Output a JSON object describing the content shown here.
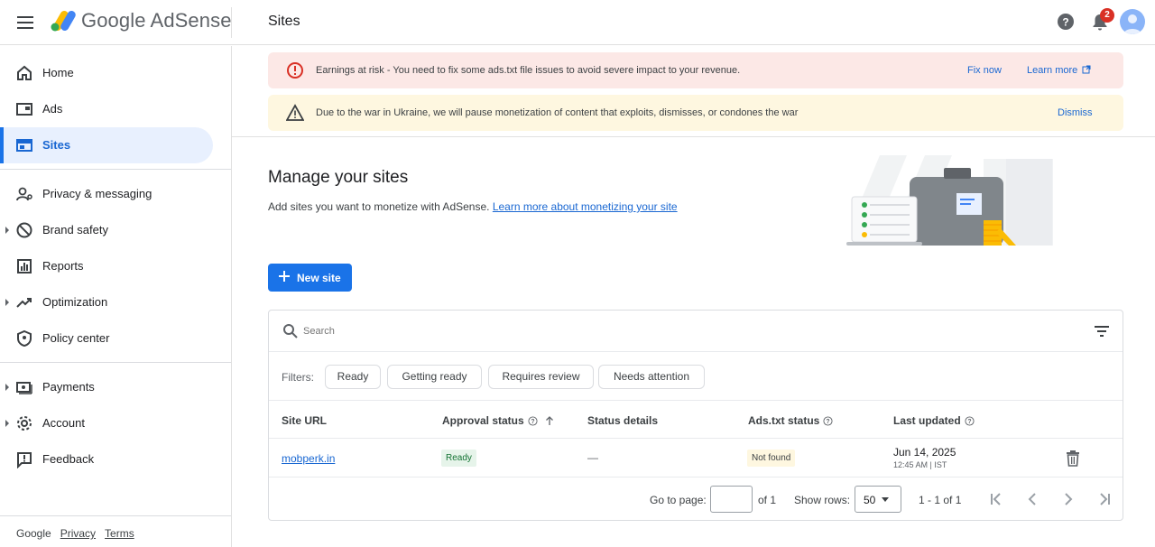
{
  "header": {
    "logo_text": "Google AdSense",
    "page_title": "Sites",
    "notification_count": "2"
  },
  "sidebar": {
    "items": [
      {
        "label": "Home",
        "icon": "home-icon"
      },
      {
        "label": "Ads",
        "icon": "ads-icon"
      },
      {
        "label": "Sites",
        "icon": "sites-icon",
        "active": true
      },
      {
        "label": "Privacy & messaging",
        "icon": "privacy-icon"
      },
      {
        "label": "Brand safety",
        "icon": "block-icon"
      },
      {
        "label": "Reports",
        "icon": "reports-icon"
      },
      {
        "label": "Optimization",
        "icon": "trending-icon"
      },
      {
        "label": "Policy center",
        "icon": "shield-icon"
      },
      {
        "label": "Payments",
        "icon": "payments-icon"
      },
      {
        "label": "Account",
        "icon": "gear-icon"
      },
      {
        "label": "Feedback",
        "icon": "feedback-icon"
      }
    ],
    "footer": {
      "brand": "Google",
      "privacy": "Privacy",
      "terms": "Terms"
    }
  },
  "banners": {
    "risk": {
      "text": "Earnings at risk - You need to fix some ads.txt file issues to avoid severe impact to your revenue.",
      "fix_now": "Fix now",
      "learn_more": "Learn more"
    },
    "ukraine": {
      "text": "Due to the war in Ukraine, we will pause monetization of content that exploits, dismisses, or condones the war",
      "dismiss": "Dismiss"
    }
  },
  "main": {
    "heading": "Manage your sites",
    "subtext": "Add sites you want to monetize with AdSense.",
    "subtext_link": "Learn more about monetizing your site",
    "new_site_label": "New site"
  },
  "table": {
    "search_placeholder": "Search",
    "filters_label": "Filters:",
    "filter_chips": [
      "Ready",
      "Getting ready",
      "Requires review",
      "Needs attention"
    ],
    "columns": [
      "Site URL",
      "Approval status",
      "Status details",
      "Ads.txt status",
      "Last updated"
    ],
    "rows": [
      {
        "site_url": "mobperk.in",
        "approval_status": "Ready",
        "status_details": "—",
        "ads_txt_status": "Not found",
        "last_updated_date": "Jun 14, 2025",
        "last_updated_time": "12:45 AM | IST"
      }
    ],
    "pager": {
      "go_to_page": "Go to page:",
      "of_pages": "of 1",
      "show_rows": "Show rows:",
      "rows_value": "50",
      "range": "1 - 1 of 1"
    }
  },
  "colors": {
    "accent": "#1a73e8",
    "risk_bg": "#fce8e6",
    "warning_bg": "#fef7e0",
    "ready_bg": "#e6f4ea",
    "badge_red": "#d93025"
  }
}
